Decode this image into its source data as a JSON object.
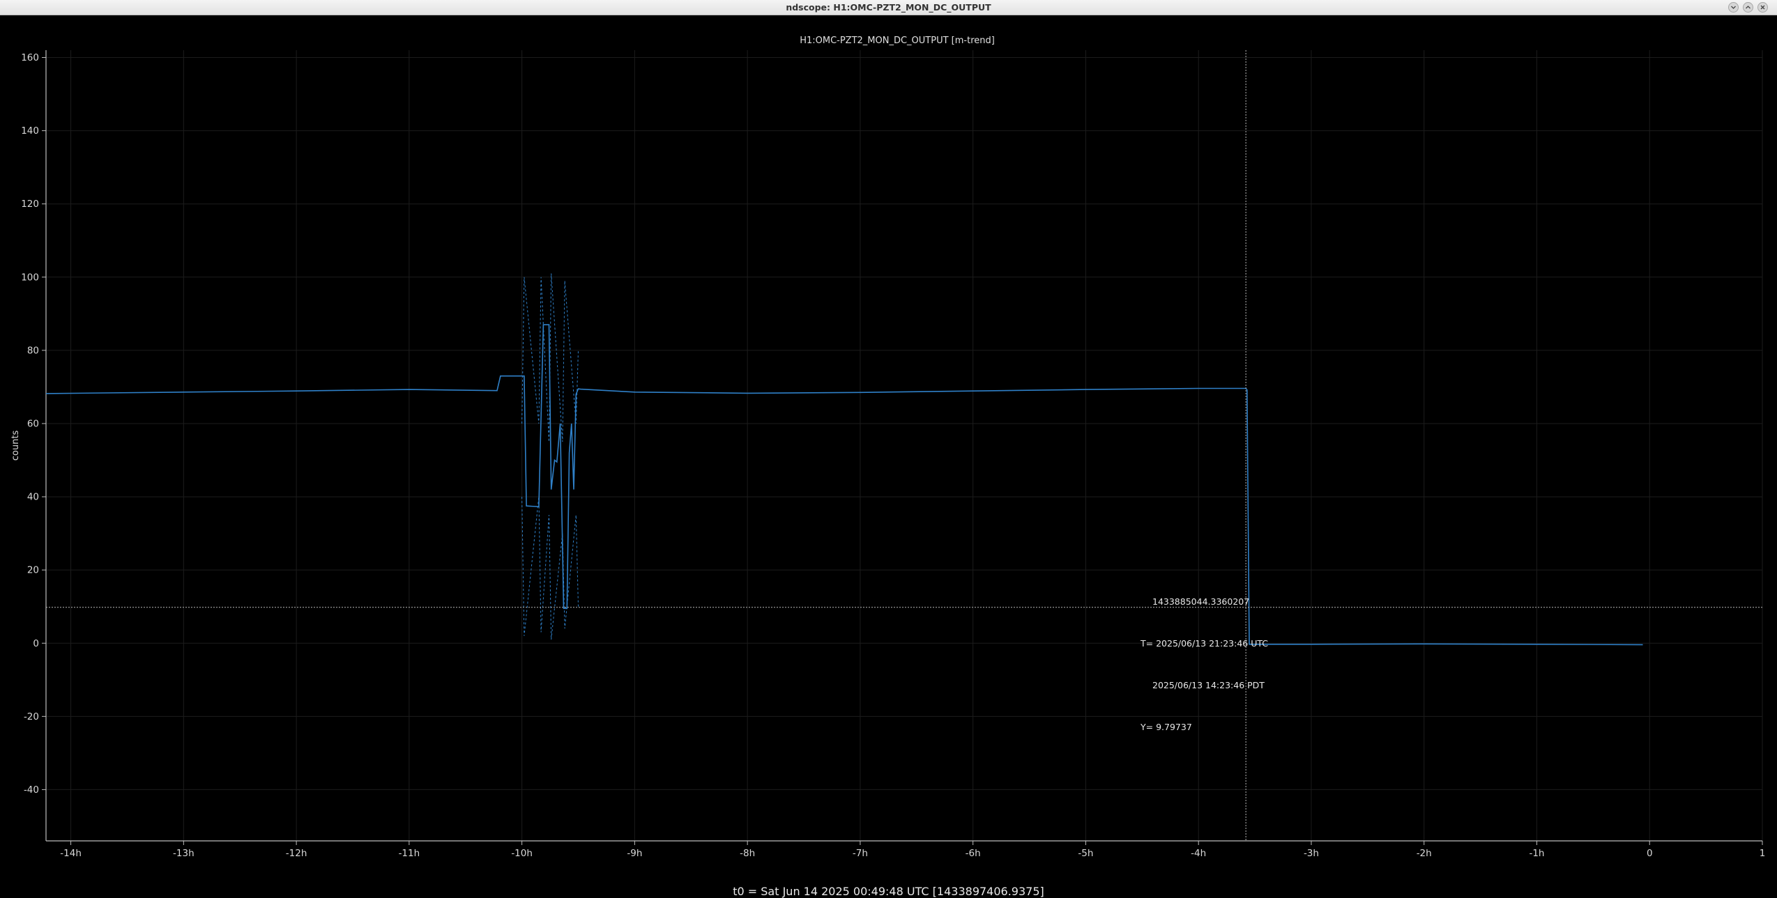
{
  "window": {
    "title": "ndscope: H1:OMC-PZT2_MON_DC_OUTPUT",
    "buttons": [
      {
        "name": "minimize",
        "icon": "chevron-down-icon"
      },
      {
        "name": "maximize",
        "icon": "chevron-up-icon"
      },
      {
        "name": "close",
        "icon": "close-icon"
      }
    ]
  },
  "colors": {
    "background": "#000000",
    "trace": "#2f80c8",
    "grid": "#1c1c1c",
    "axis": "#bdbdbd",
    "crosshair": "#b8b8b8"
  },
  "chart_data": {
    "type": "line",
    "title": "H1:OMC-PZT2_MON_DC_OUTPUT [m-trend]",
    "xlabel": "",
    "ylabel": "counts",
    "x_unit": "hours relative to t0",
    "xlim": [
      -14.22,
      1
    ],
    "ylim": [
      -54,
      162
    ],
    "xticks": [
      -14,
      -13,
      -12,
      -11,
      -10,
      -9,
      -8,
      -7,
      -6,
      -5,
      -4,
      -3,
      -2,
      -1,
      0,
      1
    ],
    "xtick_labels": [
      "-14h",
      "-13h",
      "-12h",
      "-11h",
      "-10h",
      "-9h",
      "-8h",
      "-7h",
      "-6h",
      "-5h",
      "-4h",
      "-3h",
      "-2h",
      "-1h",
      "0",
      "1"
    ],
    "yticks": [
      -40,
      -20,
      0,
      20,
      40,
      60,
      80,
      100,
      120,
      140,
      160
    ],
    "grid": true,
    "series": [
      {
        "stat": "mean",
        "style": "solid",
        "x": [
          -14.22,
          -13.0,
          -12.0,
          -11.0,
          -10.22,
          -10.19,
          -9.98,
          -9.96,
          -9.85,
          -9.81,
          -9.76,
          -9.74,
          -9.71,
          -9.69,
          -9.66,
          -9.63,
          -9.6,
          -9.58,
          -9.56,
          -9.54,
          -9.52,
          -9.5,
          -9.48,
          -9.0,
          -8.0,
          -7.0,
          -6.0,
          -5.0,
          -4.0,
          -3.58,
          -3.57,
          -3.55,
          -3.0,
          -2.0,
          -1.0,
          -0.06
        ],
        "y": [
          68.2,
          68.6,
          68.9,
          69.3,
          69.0,
          73.0,
          73.0,
          37.5,
          37.3,
          87.0,
          87.0,
          42.0,
          50.0,
          49.5,
          60.0,
          9.5,
          9.5,
          52.0,
          60.0,
          42.0,
          68.0,
          69.5,
          69.4,
          68.6,
          68.3,
          68.5,
          68.9,
          69.3,
          69.6,
          69.6,
          69.2,
          -0.3,
          -0.3,
          -0.2,
          -0.3,
          -0.4
        ]
      },
      {
        "stat": "max",
        "style": "dashed",
        "x": [
          -10.0,
          -9.98,
          -9.85,
          -9.83,
          -9.76,
          -9.74,
          -9.64,
          -9.62,
          -9.52,
          -9.5
        ],
        "y": [
          60,
          100,
          60,
          100,
          55,
          101,
          55,
          99,
          60,
          80
        ]
      },
      {
        "stat": "min",
        "style": "dashed",
        "x": [
          -10.0,
          -9.98,
          -9.85,
          -9.83,
          -9.76,
          -9.74,
          -9.64,
          -9.62,
          -9.52,
          -9.5
        ],
        "y": [
          40,
          2,
          40,
          3,
          35,
          1,
          30,
          4,
          35,
          10
        ]
      }
    ],
    "crosshair": {
      "x": -3.58,
      "y": 9.79737
    }
  },
  "cursor": {
    "gps": "1433885044.3360207",
    "utc": "T= 2025/06/13 21:23:46 UTC",
    "local": "2025/06/13 14:23:46 PDT",
    "y": "Y= 9.79737"
  },
  "footer": {
    "t0": "t0 = Sat Jun 14 2025 00:49:48 UTC [1433897406.9375]"
  }
}
